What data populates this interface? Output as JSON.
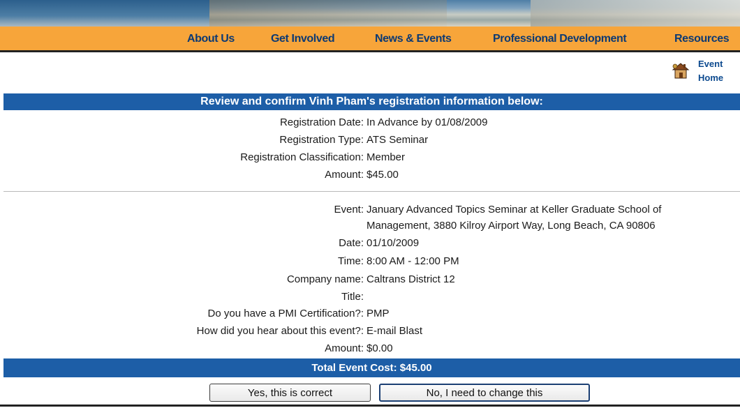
{
  "nav": {
    "items": [
      "About Us",
      "Get Involved",
      "News & Events",
      "Professional Development",
      "Resources"
    ]
  },
  "event_home": {
    "line1": "Event",
    "line2": "Home"
  },
  "review": {
    "heading": "Review and confirm Vinh Pham's registration information below:",
    "registration": [
      {
        "label": "Registration Date:",
        "value": "In Advance by 01/08/2009"
      },
      {
        "label": "Registration Type:",
        "value": "ATS Seminar"
      },
      {
        "label": "Registration Classification:",
        "value": "Member"
      },
      {
        "label": "Amount:",
        "value": "$45.00"
      }
    ],
    "event_label": "Event:",
    "event_value_line1": "January Advanced Topics Seminar at Keller Graduate School of",
    "event_value_line2": "Management, 3880 Kilroy Airport Way, Long Beach, CA 90806",
    "details": [
      {
        "label": "Date:",
        "value": "01/10/2009"
      },
      {
        "label": "Time:",
        "value": "8:00 AM - 12:00 PM"
      },
      {
        "label": "Company name:",
        "value": "Caltrans District 12"
      },
      {
        "label": "Title:",
        "value": ""
      },
      {
        "label": "Do you have a PMI Certification?:",
        "value": "PMP"
      },
      {
        "label": "How did you hear about this event?:",
        "value": "E-mail Blast"
      },
      {
        "label": "Amount:",
        "value": "$0.00"
      }
    ],
    "total": "Total Event Cost: $45.00"
  },
  "buttons": {
    "confirm": "Yes, this is correct",
    "change": "No, I need to change this"
  },
  "colors": {
    "nav_bg": "#f7a53a",
    "nav_text": "#0d3a73",
    "section_bar": "#1d5ea7"
  }
}
